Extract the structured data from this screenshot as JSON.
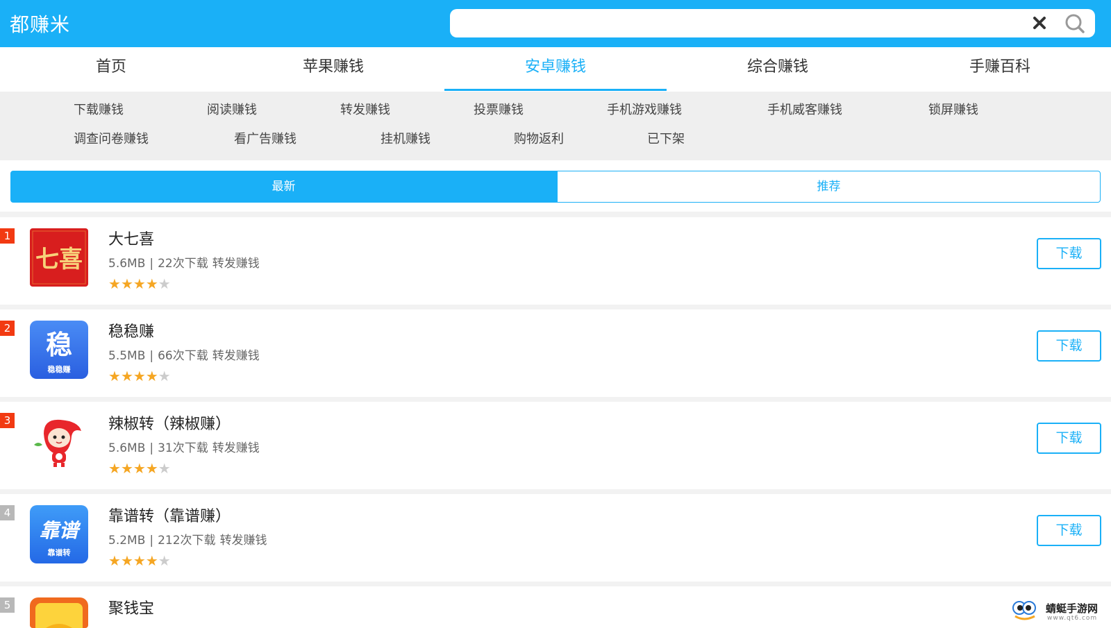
{
  "header": {
    "logo": "都赚米",
    "search": {
      "value": "",
      "placeholder": ""
    }
  },
  "tabs": [
    {
      "label": "首页"
    },
    {
      "label": "苹果赚钱"
    },
    {
      "label": "安卓赚钱",
      "active": true
    },
    {
      "label": "综合赚钱"
    },
    {
      "label": "手赚百科"
    }
  ],
  "subcategories": [
    {
      "label": "下载赚钱"
    },
    {
      "label": "阅读赚钱"
    },
    {
      "label": "转发赚钱"
    },
    {
      "label": "投票赚钱"
    },
    {
      "label": "手机游戏赚钱"
    },
    {
      "label": "手机威客赚钱"
    },
    {
      "label": "锁屏赚钱"
    },
    {
      "label": "调查问卷赚钱"
    },
    {
      "label": "看广告赚钱"
    },
    {
      "label": "挂机赚钱"
    },
    {
      "label": "购物返利"
    },
    {
      "label": "已下架"
    }
  ],
  "sort": {
    "newest": "最新",
    "recommended": "推荐",
    "active": "newest"
  },
  "apps": [
    {
      "rank": "1",
      "name": "大七喜",
      "size": "5.6MB",
      "downloads": "22次下载",
      "category": "转发赚钱",
      "rating": 4,
      "download_label": "下载",
      "icon": "qixi-icon",
      "icon_text": "七喜"
    },
    {
      "rank": "2",
      "name": "稳稳赚",
      "size": "5.5MB",
      "downloads": "66次下载",
      "category": "转发赚钱",
      "rating": 4,
      "download_label": "下载",
      "icon": "wenwenzhuan-icon",
      "icon_text": "稳",
      "icon_sub": "稳稳赚"
    },
    {
      "rank": "3",
      "name": "辣椒转（辣椒赚）",
      "size": "5.6MB",
      "downloads": "31次下载",
      "category": "转发赚钱",
      "rating": 4,
      "download_label": "下载",
      "icon": "chili-mascot-icon"
    },
    {
      "rank": "4",
      "name": "靠谱转（靠谱赚）",
      "size": "5.2MB",
      "downloads": "212次下载",
      "category": "转发赚钱",
      "rating": 4,
      "download_label": "下载",
      "icon": "kaopuzhuan-icon",
      "icon_text": "靠谱",
      "icon_sub": "靠谱转"
    },
    {
      "rank": "5",
      "name": "聚钱宝",
      "icon": "juqianbao-icon"
    }
  ],
  "watermark": {
    "text": "蜻蜓手游网",
    "url": "www.qt6.com"
  },
  "colors": {
    "accent": "#1ab0f7",
    "rank_hot": "#f23a12",
    "rank_cold": "#b8b8b8",
    "star": "#f5a623"
  }
}
